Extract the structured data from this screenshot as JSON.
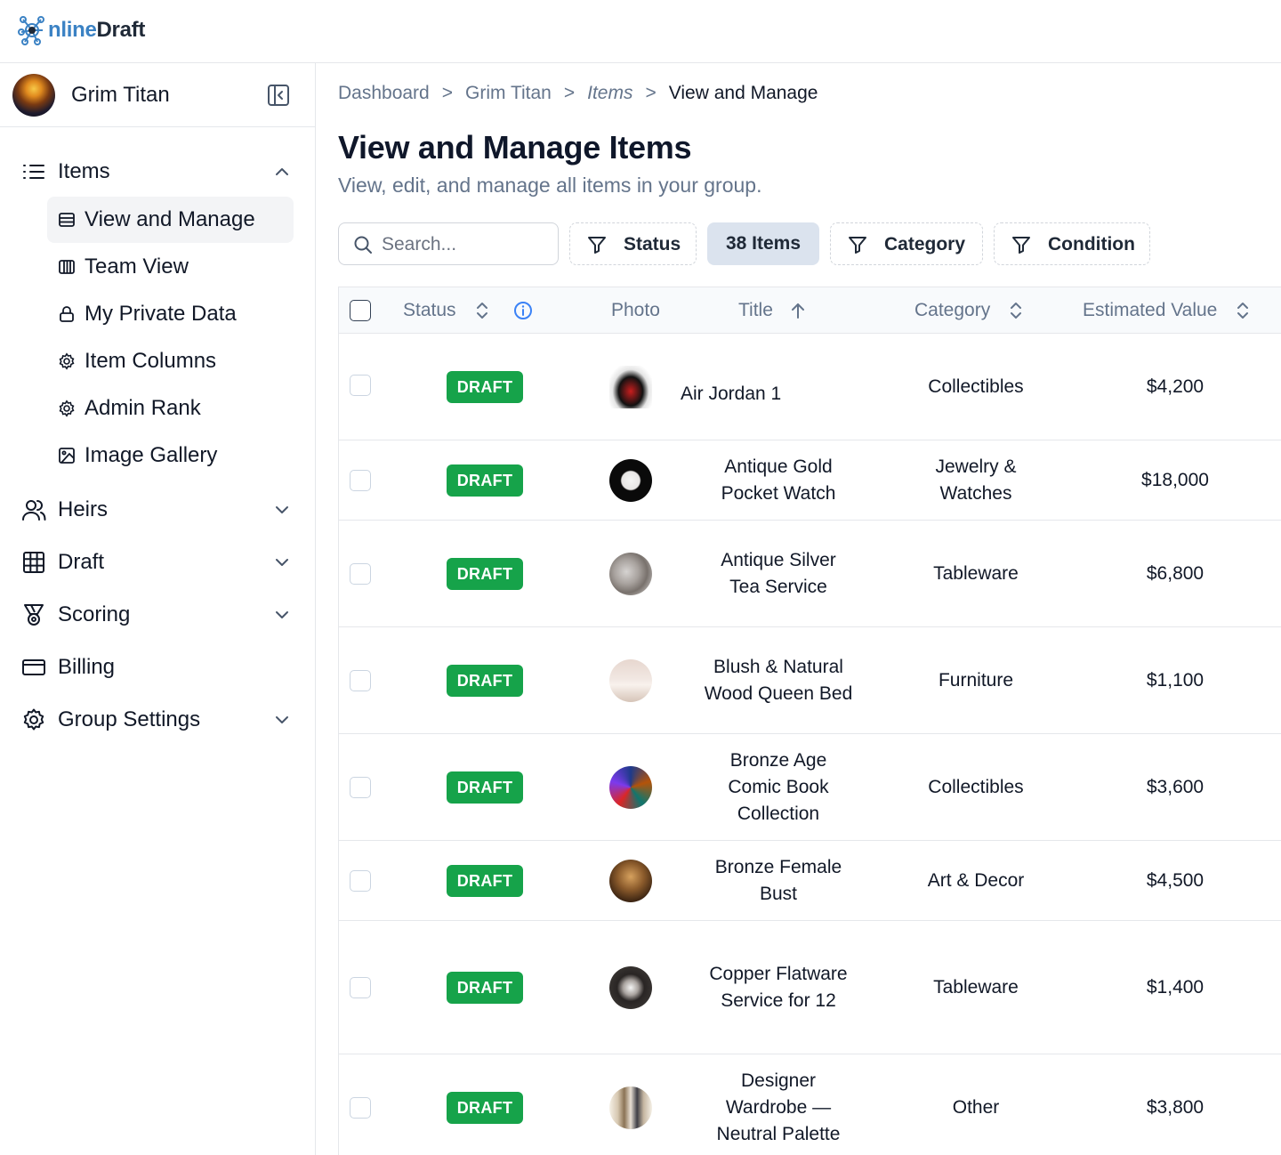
{
  "app": {
    "logo_text_a": "nline",
    "logo_text_b": "Draft"
  },
  "profile": {
    "name": "Grim Titan"
  },
  "sidebar": {
    "items_label": "Items",
    "sub_items": [
      {
        "label": "View and Manage",
        "icon": "list-icon",
        "active": true
      },
      {
        "label": "Team View",
        "icon": "columns-icon",
        "active": false
      },
      {
        "label": "My Private Data",
        "icon": "lock-icon",
        "active": false
      },
      {
        "label": "Item Columns",
        "icon": "gear-icon",
        "active": false
      },
      {
        "label": "Admin Rank",
        "icon": "gear-icon",
        "active": false
      },
      {
        "label": "Image Gallery",
        "icon": "image-icon",
        "active": false
      }
    ],
    "sections": [
      {
        "label": "Heirs",
        "icon": "users-icon",
        "expandable": true
      },
      {
        "label": "Draft",
        "icon": "grid-icon",
        "expandable": true
      },
      {
        "label": "Scoring",
        "icon": "medal-icon",
        "expandable": true
      },
      {
        "label": "Billing",
        "icon": "credit-card-icon",
        "expandable": false
      },
      {
        "label": "Group Settings",
        "icon": "gear-icon",
        "expandable": true
      }
    ]
  },
  "breadcrumb": [
    "Dashboard",
    "Grim Titan",
    "Items",
    "View and Manage"
  ],
  "page": {
    "title": "View and Manage Items",
    "subtitle": "View, edit, and manage all items in your group."
  },
  "toolbar": {
    "search_placeholder": "Search...",
    "status_label": "Status",
    "count_label": "38 Items",
    "category_label": "Category",
    "condition_label": "Condition"
  },
  "table": {
    "headers": {
      "status": "Status",
      "photo": "Photo",
      "title": "Title",
      "category": "Category",
      "value": "Estimated Value"
    },
    "rows": [
      {
        "status": "DRAFT",
        "photo": "sneaker",
        "title_lines": [
          "Air Jordan 1"
        ],
        "category_lines": [
          "Collectibles"
        ],
        "value": "$4,200"
      },
      {
        "status": "DRAFT",
        "photo": "watch",
        "title_lines": [
          "Antique Gold",
          "Pocket Watch"
        ],
        "category_lines": [
          "Jewelry &",
          "Watches"
        ],
        "value": "$18,000"
      },
      {
        "status": "DRAFT",
        "photo": "teaset",
        "title_lines": [
          "Antique Silver",
          "Tea Service"
        ],
        "category_lines": [
          "Tableware"
        ],
        "value": "$6,800"
      },
      {
        "status": "DRAFT",
        "photo": "bed",
        "title_lines": [
          "Blush & Natural",
          "Wood Queen Bed"
        ],
        "category_lines": [
          "Furniture"
        ],
        "value": "$1,100"
      },
      {
        "status": "DRAFT",
        "photo": "comics",
        "title_lines": [
          "Bronze Age",
          "Comic Book",
          "Collection"
        ],
        "category_lines": [
          "Collectibles"
        ],
        "value": "$3,600"
      },
      {
        "status": "DRAFT",
        "photo": "bust",
        "title_lines": [
          "Bronze Female",
          "Bust"
        ],
        "category_lines": [
          "Art & Decor"
        ],
        "value": "$4,500"
      },
      {
        "status": "DRAFT",
        "photo": "flatware",
        "title_lines": [
          "Copper Flatware",
          "Service for 12"
        ],
        "category_lines": [
          "Tableware"
        ],
        "value": "$1,400"
      },
      {
        "status": "DRAFT",
        "photo": "wardrobe",
        "title_lines": [
          "Designer",
          "Wardrobe —",
          "Neutral Palette"
        ],
        "category_lines": [
          "Other"
        ],
        "value": "$3,800"
      }
    ]
  },
  "colors": {
    "badge": "#16a34a",
    "logo_blue": "#3b82c4",
    "info_blue": "#3b82f6"
  }
}
